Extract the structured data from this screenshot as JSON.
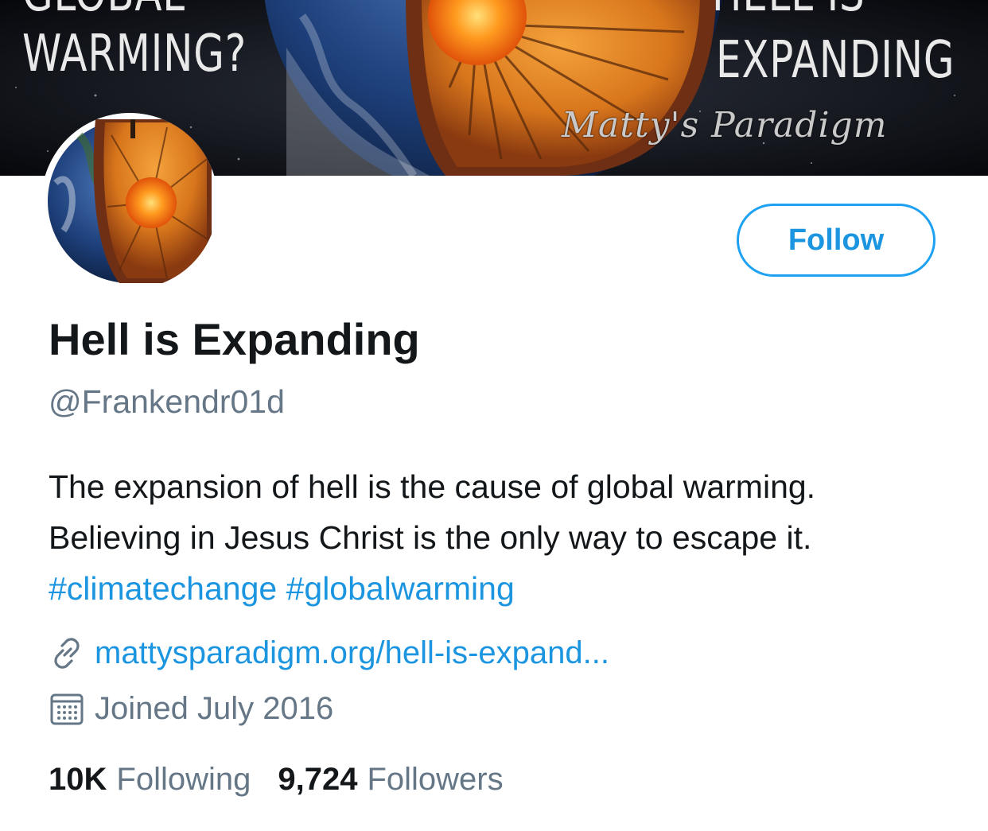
{
  "banner": {
    "left_top_text": "GLOBAL",
    "left_text": "WARMING?",
    "right_top_text": "HELL IS",
    "right_text": "EXPANDING",
    "signature": "Matty's Paradigm"
  },
  "profile": {
    "name": "Hell is Expanding",
    "handle": "@Frankendr01d",
    "follow_label": "Follow",
    "bio": {
      "text": "The expansion of hell is the cause of global warming. Believing in Jesus Christ is the only way to escape it.",
      "hashtags": [
        "#climatechange",
        "#globalwarming"
      ]
    },
    "website": "mattysparadigm.org/hell-is-expand...",
    "joined": "Joined July 2016",
    "stats": [
      {
        "count": "10K",
        "label": "Following"
      },
      {
        "count": "9,724",
        "label": "Followers"
      }
    ]
  },
  "icons": {
    "link": "link-icon",
    "calendar": "calendar-icon"
  },
  "colors": {
    "accent": "#1da1f2",
    "link": "#1b95e0",
    "secondary_text": "#657786",
    "primary_text": "#14171a"
  }
}
